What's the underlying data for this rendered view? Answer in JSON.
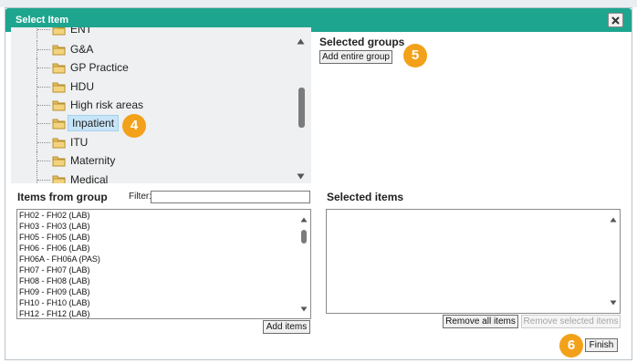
{
  "dialog": {
    "title": "Select Item",
    "close_icon": "close-x-icon"
  },
  "tree": {
    "items": [
      {
        "label": "ENT"
      },
      {
        "label": "G&A"
      },
      {
        "label": "GP Practice"
      },
      {
        "label": "HDU"
      },
      {
        "label": "High risk areas"
      },
      {
        "label": "Inpatient"
      },
      {
        "label": "ITU"
      },
      {
        "label": "Maternity"
      },
      {
        "label": "Medical"
      }
    ],
    "selected_label": "Inpatient",
    "folder_icon": "folder-icon"
  },
  "callouts": {
    "step4": "4",
    "step5": "5",
    "step6": "6"
  },
  "selected_groups": {
    "heading": "Selected groups",
    "add_entire_group_label": "Add entire group"
  },
  "items_from_group": {
    "heading": "Items from group",
    "filter_label": "Filter:",
    "filter_value": "",
    "items": [
      "FH02 - FH02 (LAB)",
      "FH03 - FH03 (LAB)",
      "FH05 - FH05 (LAB)",
      "FH06 - FH06 (LAB)",
      "FH06A - FH06A (PAS)",
      "FH07 - FH07 (LAB)",
      "FH08 - FH08 (LAB)",
      "FH09 - FH09 (LAB)",
      "FH10 - FH10 (LAB)",
      "FH12 - FH12 (LAB)"
    ],
    "add_items_label": "Add items"
  },
  "selected_items": {
    "heading": "Selected items",
    "remove_all_label": "Remove all items",
    "remove_selected_label": "Remove selected items"
  },
  "footer": {
    "finish_label": "Finish"
  },
  "colors": {
    "titlebar": "#1ea58f",
    "badge": "#f3a11a",
    "selected_bg": "#c7e5f8"
  }
}
